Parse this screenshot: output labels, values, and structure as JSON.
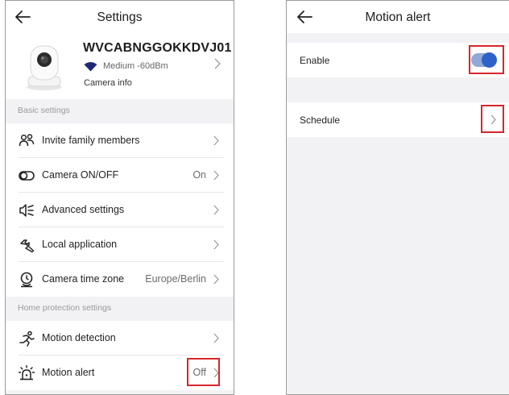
{
  "left": {
    "title": "Settings",
    "device": {
      "name": "WVCABNGGOKKDVJ01",
      "signal": "Medium -60dBm",
      "info_label": "Camera info"
    },
    "section_basic": "Basic settings",
    "section_home": "Home protection settings",
    "rows": [
      {
        "label": "Invite family members",
        "value": "",
        "icon": "people-icon"
      },
      {
        "label": "Camera ON/OFF",
        "value": "On",
        "icon": "toggle-icon"
      },
      {
        "label": "Advanced settings",
        "value": "",
        "icon": "speaker-icon"
      },
      {
        "label": "Local application",
        "value": "",
        "icon": "wrench-icon"
      },
      {
        "label": "Camera time zone",
        "value": "Europe/Berlin",
        "icon": "clock-pin-icon"
      },
      {
        "label": "Motion detection",
        "value": "",
        "icon": "running-icon"
      },
      {
        "label": "Motion alert",
        "value": "Off",
        "icon": "alarm-icon"
      }
    ]
  },
  "right": {
    "title": "Motion alert",
    "enable_label": "Enable",
    "enable_on": true,
    "schedule_label": "Schedule"
  },
  "colors": {
    "highlight": "#d8262b",
    "toggle_knob": "#2d63c8",
    "toggle_track": "#8fa8d8",
    "background": "#f2f2f4"
  }
}
